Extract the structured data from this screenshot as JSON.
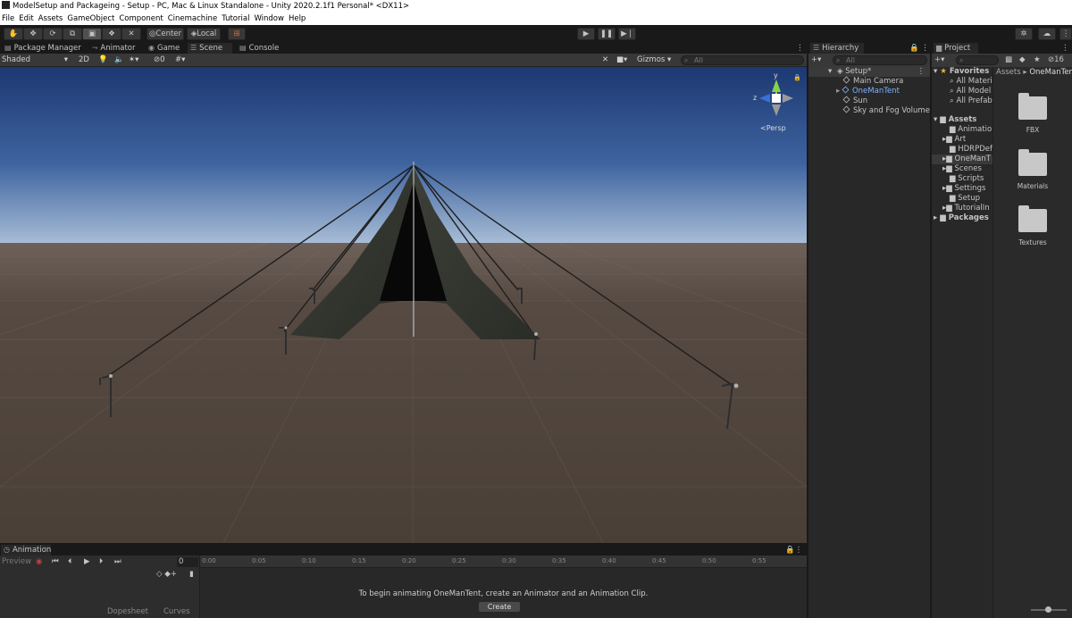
{
  "window": {
    "title": "ModelSetup and Packageing - Setup - PC, Mac & Linux Standalone - Unity 2020.2.1f1 Personal* <DX11>"
  },
  "menu": [
    "File",
    "Edit",
    "Assets",
    "GameObject",
    "Component",
    "Cinemachine",
    "Tutorial",
    "Window",
    "Help"
  ],
  "toolbar": {
    "pivot_label": "Center",
    "space_label": "Local"
  },
  "scene_panel": {
    "tabs": [
      "Package Manager",
      "Animator",
      "Game",
      "Scene",
      "Console"
    ],
    "selected_tab": "Scene",
    "draw_mode": "Shaded",
    "toggle_2d": "2D",
    "hidden_count": "0",
    "gizmos_label": "Gizmos",
    "search_placeholder": "All",
    "persp_label": "Persp",
    "axis_y": "y",
    "axis_z": "z"
  },
  "animation_panel": {
    "tab": "Animation",
    "preview_label": "Preview",
    "frame_value": "0",
    "timeline_ticks": [
      "0:00",
      "0:05",
      "0:10",
      "0:15",
      "0:20",
      "0:25",
      "0:30",
      "0:35",
      "0:40",
      "0:45",
      "0:50",
      "0:55"
    ],
    "message": "To begin animating OneManTent, create an Animator and an Animation Clip.",
    "create_label": "Create",
    "dopesheet_label": "Dopesheet",
    "curves_label": "Curves"
  },
  "hierarchy": {
    "tab": "Hierarchy",
    "search_placeholder": "All",
    "scene_name": "Setup*",
    "items": [
      "Main Camera",
      "OneManTent",
      "Sun",
      "Sky and Fog Volume"
    ]
  },
  "project": {
    "tab": "Project",
    "hidden_count": "16",
    "favorites_label": "Favorites",
    "favorites": [
      "All Materi",
      "All Model",
      "All Prefab"
    ],
    "assets_label": "Assets",
    "asset_folders": [
      "Animation",
      "Art",
      "HDRPDef",
      "OneManT",
      "Scenes",
      "Scripts",
      "Settings",
      "TutorialIn",
      "Setup"
    ],
    "packages_label": "Packages",
    "breadcrumb": [
      "Assets",
      "OneManTen"
    ],
    "grid_items": [
      "FBX",
      "Materials",
      "Textures"
    ]
  },
  "colors": {
    "selected_object": "#7fb3ff",
    "sky_top": "#1f3c78",
    "horizon": "#9fb6d3",
    "ground": "#4a4038",
    "record": "#c04040"
  }
}
